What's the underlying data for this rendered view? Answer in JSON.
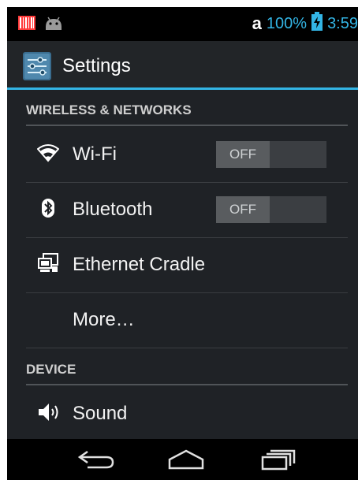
{
  "status_bar": {
    "left_icons": [
      "barcode-icon",
      "android-debug-icon"
    ],
    "amazon_label": "a",
    "battery_percent": "100%",
    "battery_icon": "battery-charging-icon",
    "time": "3:59",
    "accent_color": "#33b5e5"
  },
  "action_bar": {
    "icon": "settings-sliders-icon",
    "title": "Settings"
  },
  "sections": {
    "wireless_header": "WIRELESS & NETWORKS",
    "device_header": "DEVICE"
  },
  "items": {
    "wifi": {
      "label": "Wi-Fi",
      "icon": "wifi-icon",
      "toggle": "OFF"
    },
    "bluetooth": {
      "label": "Bluetooth",
      "icon": "bluetooth-icon",
      "toggle": "OFF"
    },
    "ethernet": {
      "label": "Ethernet Cradle",
      "icon": "ethernet-icon"
    },
    "more": {
      "label": "More…"
    },
    "sound": {
      "label": "Sound",
      "icon": "speaker-icon"
    }
  },
  "nav_bar": {
    "buttons": [
      "back-icon",
      "home-icon",
      "recent-apps-icon"
    ]
  }
}
